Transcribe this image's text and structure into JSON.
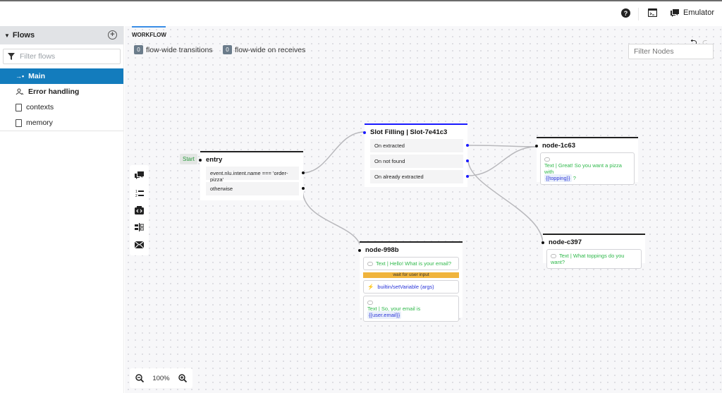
{
  "topbar": {
    "help_icon": "question-circle-icon",
    "terminal_icon": "terminal-icon",
    "emulator_label": "Emulator",
    "emulator_icon": "chat-bubbles-icon"
  },
  "sidebar": {
    "title": "Flows",
    "add_icon": "plus-circle-icon",
    "filter_placeholder": "Filter flows",
    "items": [
      {
        "label": "Main",
        "icon": "flow-arrow-icon",
        "active": true
      },
      {
        "label": "Error handling",
        "icon": "user-error-icon",
        "active": false
      },
      {
        "label": "contexts",
        "icon": "document-icon",
        "active": false
      },
      {
        "label": "memory",
        "icon": "document-icon",
        "active": false
      }
    ]
  },
  "canvas": {
    "tab_label": "WORKFLOW",
    "transitions_count": "0",
    "transitions_label": "flow-wide transitions",
    "receives_count": "0",
    "receives_label": "flow-wide on receives",
    "filter_nodes_placeholder": "Filter Nodes",
    "zoom_level": "100%",
    "toolbox": [
      "say-something-icon",
      "list-icon",
      "execute-code-icon",
      "router-icon",
      "send-email-icon"
    ]
  },
  "nodes": {
    "entry": {
      "start_label": "Start",
      "title": "entry",
      "transitions": [
        "event.nlu.intent.name === 'order-pizza'",
        "otherwise"
      ]
    },
    "slot": {
      "title": "Slot Filling | Slot-7e41c3",
      "transitions": [
        "On extracted",
        "On not found",
        "On already extracted"
      ]
    },
    "n1c63": {
      "title": "node-1c63",
      "text_prefix": "Text | Great! So you want a pizza with",
      "var": "{{topping}}",
      "text_suffix": "?"
    },
    "n998b": {
      "title": "node-998b",
      "say1": "Text | Hello! What is your email?",
      "wait": "wait for user input",
      "action": "builtin/setVariable (args)",
      "say2_prefix": "Text | So, your email is",
      "say2_var": "{{user.email}}"
    },
    "nc397": {
      "title": "node-c397",
      "say": "Text | What toppings do you want?"
    }
  }
}
